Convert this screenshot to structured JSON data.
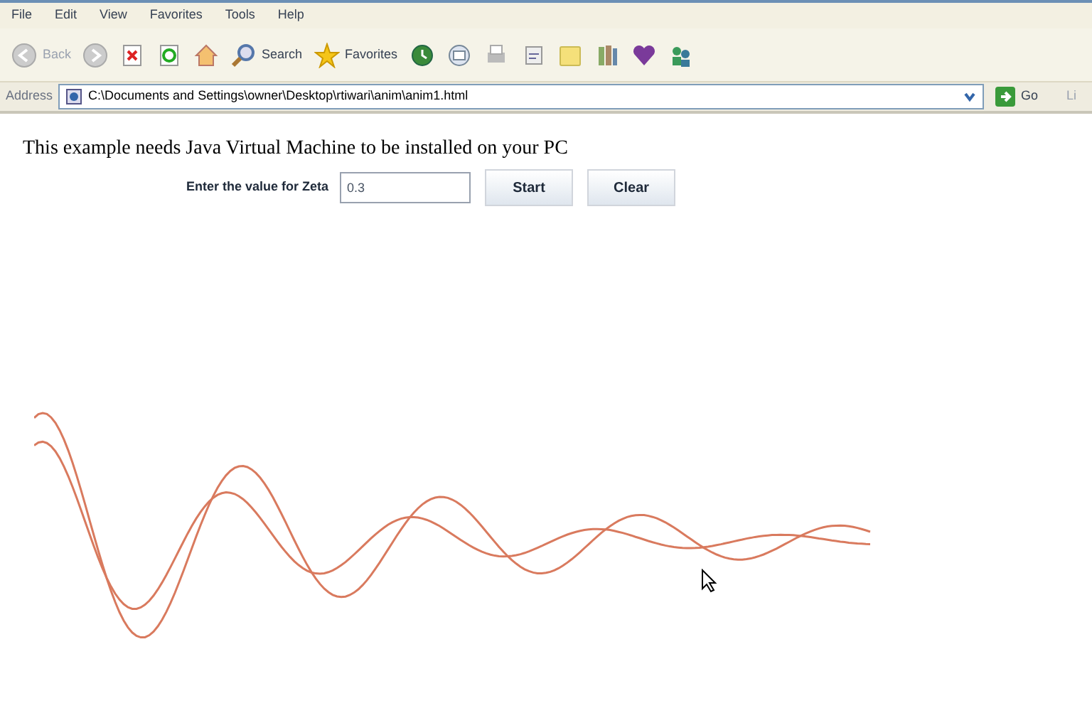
{
  "menu_bar": [
    "File",
    "Edit",
    "View",
    "Favorites",
    "Tools",
    "Help"
  ],
  "toolbar": [
    {
      "kind": "back",
      "label": "Back"
    },
    {
      "kind": "forward"
    },
    {
      "kind": "stop"
    },
    {
      "kind": "refresh"
    },
    {
      "kind": "home"
    },
    {
      "kind": "search",
      "label": "Search"
    },
    {
      "kind": "favorites",
      "label": "Favorites"
    },
    {
      "kind": "history"
    },
    {
      "kind": "mail"
    },
    {
      "kind": "print"
    },
    {
      "kind": "edit"
    },
    {
      "kind": "folder"
    },
    {
      "kind": "research"
    },
    {
      "kind": "messenger"
    },
    {
      "kind": "people"
    }
  ],
  "address_bar": {
    "label": "Address",
    "value": "C:\\Documents and Settings\\owner\\Desktop\\rtiwari\\anim\\anim1.html",
    "go": "Go",
    "links": "Li"
  },
  "page": {
    "notice": "This example needs Java Virtual Machine to be installed on your PC",
    "zeta_label": "Enter the value for Zeta",
    "zeta_value": "0.3",
    "buttons": [
      "Start",
      "Clear"
    ]
  }
}
